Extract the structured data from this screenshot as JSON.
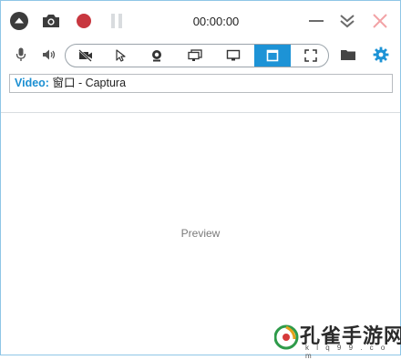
{
  "toolbar": {
    "timer": "00:00:00",
    "icons": {
      "menu": "menu-circle-icon",
      "screenshot": "camera-icon",
      "record": "record-icon",
      "pause": "pause-icon",
      "minimize": "minimize-icon",
      "collapse": "double-chevron-down-icon",
      "close": "close-icon"
    }
  },
  "sources": {
    "audio": [
      "microphone-icon",
      "speaker-icon"
    ],
    "video_modes": [
      {
        "icon": "no-video-icon",
        "selected": false
      },
      {
        "icon": "cursor-icon",
        "selected": false
      },
      {
        "icon": "webcam-icon",
        "selected": false
      },
      {
        "icon": "multi-screen-icon",
        "selected": false
      },
      {
        "icon": "screen-icon",
        "selected": false
      },
      {
        "icon": "window-icon",
        "selected": true
      },
      {
        "icon": "region-icon",
        "selected": false
      }
    ],
    "folder": "folder-icon",
    "settings": "gear-icon"
  },
  "video": {
    "label": "Video:",
    "value": "窗口 - Captura"
  },
  "preview": {
    "label": "Preview"
  },
  "watermark": {
    "title": "孔雀手游网",
    "sub": "k l q 9 9 . c o m"
  },
  "colors": {
    "accent": "#1d93d6",
    "record": "#c8373f",
    "border": "#8fc6e6"
  }
}
